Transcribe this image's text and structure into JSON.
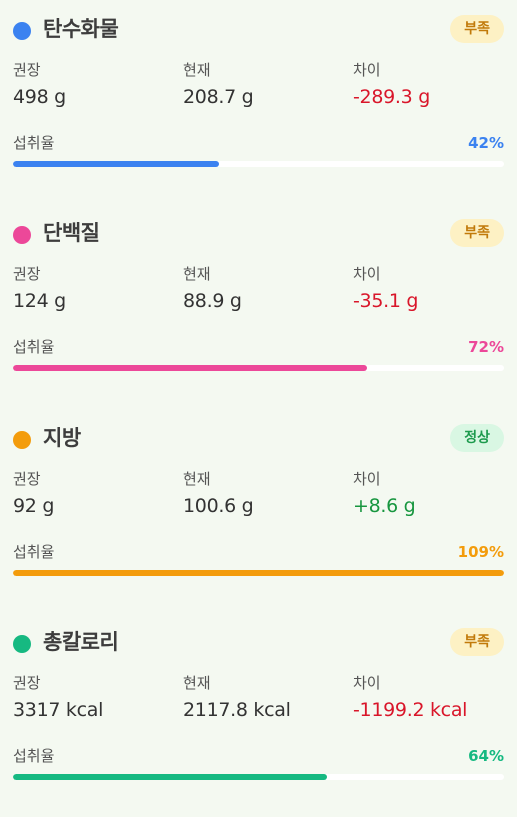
{
  "labels": {
    "recommended": "권장",
    "current": "현재",
    "difference": "차이",
    "intake_rate": "섭취율"
  },
  "nutrients": [
    {
      "name": "탄수화물",
      "color": "#3b82f0",
      "status": "부족",
      "status_type": "low",
      "recommended": "498 g",
      "current": "208.7 g",
      "difference": "-289.3 g",
      "difference_sign": "neg",
      "percent_label": "42%",
      "percent": 42
    },
    {
      "name": "단백질",
      "color": "#ec4899",
      "status": "부족",
      "status_type": "low",
      "recommended": "124 g",
      "current": "88.9 g",
      "difference": "-35.1 g",
      "difference_sign": "neg",
      "percent_label": "72%",
      "percent": 72
    },
    {
      "name": "지방",
      "color": "#f39c0c",
      "status": "정상",
      "status_type": "ok",
      "recommended": "92 g",
      "current": "100.6 g",
      "difference": "+8.6 g",
      "difference_sign": "pos",
      "percent_label": "109%",
      "percent": 109
    },
    {
      "name": "총칼로리",
      "color": "#16b981",
      "status": "부족",
      "status_type": "low",
      "recommended": "3317 kcal",
      "current": "2117.8 kcal",
      "difference": "-1199.2 kcal",
      "difference_sign": "neg",
      "percent_label": "64%",
      "percent": 64
    }
  ]
}
